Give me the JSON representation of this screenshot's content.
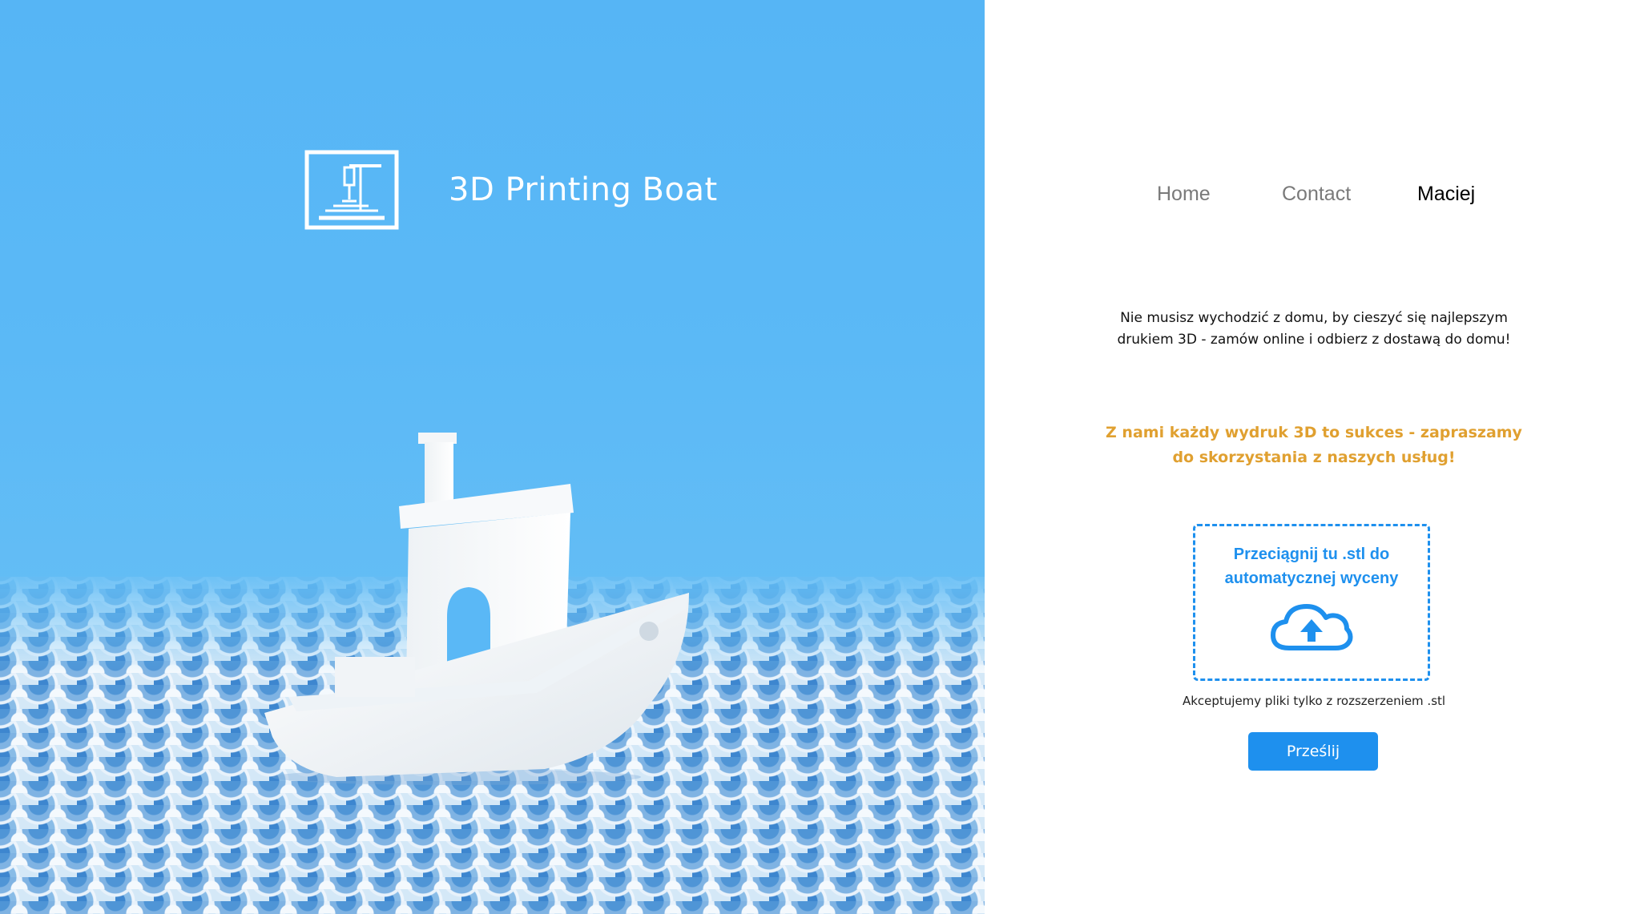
{
  "brand": {
    "name": "3D Printing Boat",
    "logo_icon": "3d-printer-icon"
  },
  "hero": {
    "image": "3d-printed-benchy-boat-on-blue-tiles"
  },
  "nav": {
    "items": [
      {
        "label": "Home"
      },
      {
        "label": "Contact"
      },
      {
        "label": "Maciej",
        "active": true
      }
    ]
  },
  "intro": {
    "line1": "Nie musisz wychodzić z domu, by cieszyć się najlepszym",
    "line2": "drukiem 3D - zamów online i odbierz z dostawą do domu!"
  },
  "promo": {
    "line1": "Z nami każdy wydruk 3D to sukces - zapraszamy",
    "line2": "do skorzystania z naszych usług!"
  },
  "upload": {
    "dropzone_line1": "Przeciągnij tu .stl do",
    "dropzone_line2": "automatycznej wyceny",
    "icon": "cloud-upload-icon",
    "accept_note": "Akceptujemy pliki tylko z rozszerzeniem .stl",
    "submit_label": "Prześlij"
  },
  "colors": {
    "sky": "#5ab8f6",
    "accent_blue": "#1e90ee",
    "promo_orange": "#e0a030"
  }
}
